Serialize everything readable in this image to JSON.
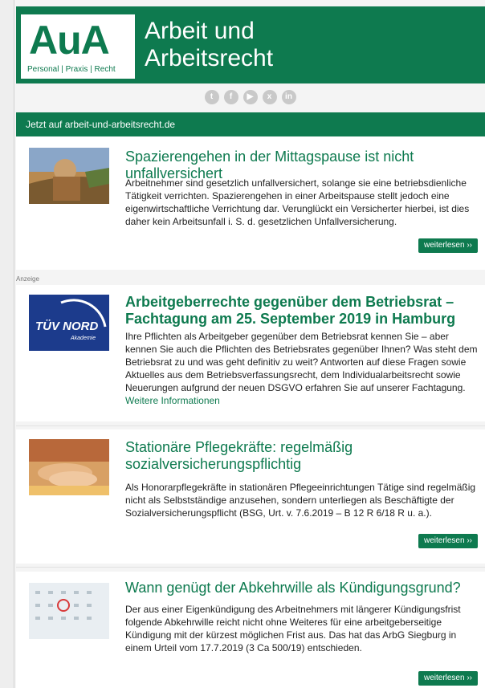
{
  "header": {
    "logo_main": "AuA",
    "logo_sub": "Personal | Praxis | Recht",
    "title_line1": "Arbeit und",
    "title_line2": "Arbeitsrecht"
  },
  "social": {
    "icons": [
      {
        "name": "twitter-icon",
        "glyph": "t"
      },
      {
        "name": "facebook-icon",
        "glyph": "f"
      },
      {
        "name": "youtube-icon",
        "glyph": "▶"
      },
      {
        "name": "xing-icon",
        "glyph": "x"
      },
      {
        "name": "linkedin-icon",
        "glyph": "in"
      }
    ]
  },
  "bar": {
    "text": "Jetzt auf arbeit-und-arbeitsrecht.de"
  },
  "ad_label": "Anzeige",
  "articles": [
    {
      "title": "Spazierengehen in der Mittagspause ist nicht unfallversichert",
      "body": "Arbeitnehmer sind gesetzlich unfallversichert, solange sie eine betriebsdienliche Tätigkeit verrichten. Spazierengehen in einer Arbeitspause stellt jedoch eine eigenwirtschaftliche Verrichtung dar. Verunglückt ein Versicherter hierbei, ist dies daher kein Arbeitsunfall i. S. d. gesetzlichen Unfallversicherung.",
      "button": "weiterlesen ››"
    },
    {
      "title": "Arbeitgeberrechte gegenüber dem Betriebsrat – Fachtagung am 25. September 2019 in Hamburg",
      "body": "Ihre Pflichten als Arbeitgeber gegenüber dem Betriebsrat kennen Sie – aber kennen Sie auch die Pflichten des Betriebsrates gegenüber Ihnen? Was steht dem Betriebsrat zu und was geht definitiv zu weit? Antworten auf diese Fragen sowie Aktuelles aus dem Betriebsverfassungsrecht, dem Individualarbeitsrecht sowie Neuerungen aufgrund der neuen DSGVO erfahren Sie auf unserer Fachtagung.",
      "link": "Weitere Informationen",
      "logo_main": "TÜV NORD",
      "logo_sub": "Akademie"
    },
    {
      "title": "Stationäre Pflegekräfte: regelmäßig sozialversicherungspflichtig",
      "body": "Als Honorarpflegekräfte in stationären Pflegeeinrichtungen Tätige sind regelmäßig nicht als Selbstständige anzusehen, sondern unterliegen als Beschäftigte der Sozialversicherungspflicht (BSG, Urt. v. 7.6.2019 – B 12 R 6/18 R u. a.).",
      "button": "weiterlesen ››"
    },
    {
      "title": "Wann genügt der Abkehrwille als Kündigungsgrund?",
      "body": "Der aus einer Eigenkündigung des Arbeitnehmers mit längerer Kündigungsfrist folgende Abkehrwille reicht nicht ohne Weiteres für eine arbeitgeberseitige Kündigung mit der kürzest möglichen Frist aus. Das hat das ArbG Siegburg in einem Urteil vom 17.7.2019 (3 Ca 500/19) entschieden.",
      "button": "weiterlesen ››"
    }
  ]
}
